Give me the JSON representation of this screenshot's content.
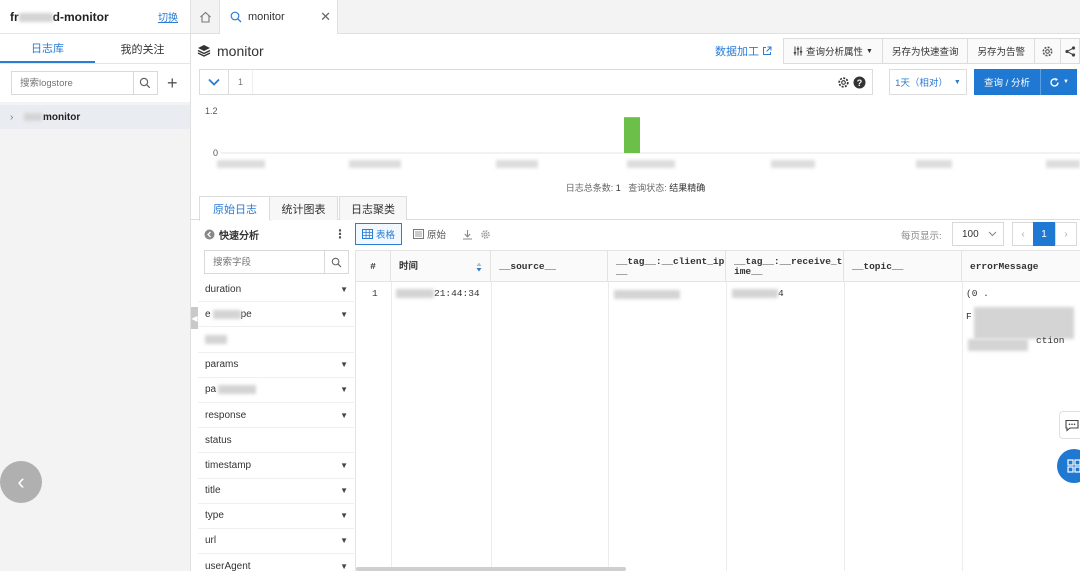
{
  "sidebar": {
    "project_prefix": "fr",
    "project_suffix": "d-monitor",
    "switch_label": "切换",
    "tabs": [
      {
        "label": "日志库",
        "active": true
      },
      {
        "label": "我的关注",
        "active": false
      }
    ],
    "search_placeholder": "搜索logstore",
    "logstores": [
      {
        "name": "monitor"
      }
    ]
  },
  "tab_bar": {
    "tab_label": "monitor"
  },
  "toolbar": {
    "title": "monitor",
    "data_process_label": "数据加工",
    "query_props_label": "查询分析属性",
    "save_quick_label": "另存为快速查询",
    "save_alert_label": "另存为告警"
  },
  "query": {
    "line_number": "1",
    "text": "",
    "time_range": "1天（相对）",
    "query_button": "查询 / 分析"
  },
  "histogram": {
    "y_ticks": [
      "1.2",
      "0"
    ],
    "bar_value": 1
  },
  "summary": {
    "total_label": "日志总条数:",
    "total_value": "1",
    "status_label": "查询状态:",
    "status_value": "结果精确"
  },
  "result_tabs": [
    {
      "label": "原始日志",
      "active": true
    },
    {
      "label": "统计图表",
      "active": false
    },
    {
      "label": "日志聚类",
      "active": false
    }
  ],
  "quick_analysis": {
    "title": "快速分析",
    "search_placeholder": "搜索字段",
    "fields": [
      "duration",
      "e",
      "",
      "params",
      "pa",
      "response",
      "status",
      "timestamp",
      "title",
      "type",
      "url",
      "userAgent"
    ]
  },
  "table_tools": {
    "table_view": "表格",
    "raw_view": "原始",
    "per_page_label": "每页显示:",
    "per_page_value": "100",
    "current_page": "1"
  },
  "table": {
    "columns": [
      "#",
      "时间",
      "__source__",
      "__tag__:__client_ip__",
      "__tag__:__receive_time__",
      "__topic__",
      "errorMessage"
    ],
    "rows": [
      {
        "index": "1",
        "time": "21:44:34",
        "receive_time_tail": "4",
        "error_line1": "(0 .",
        "error_line2": "F",
        "error_line3": "ction"
      }
    ]
  },
  "colors": {
    "primary": "#1f78d1",
    "link": "#2b7cd3",
    "bar": "#6cc04a"
  }
}
